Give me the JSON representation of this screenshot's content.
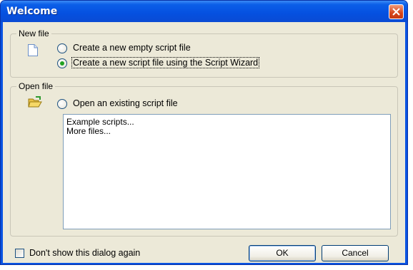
{
  "window": {
    "title": "Welcome"
  },
  "new_file": {
    "legend": "New file",
    "options": [
      {
        "label": "Create a new empty script file",
        "checked": false
      },
      {
        "label": "Create a new script file using the Script Wizard",
        "checked": true
      }
    ]
  },
  "open_file": {
    "legend": "Open file",
    "option": {
      "label": "Open an existing script file",
      "checked": false
    },
    "list_items": [
      "Example scripts...",
      "More files..."
    ]
  },
  "footer": {
    "dont_show_label": "Don't show this dialog again",
    "ok_label": "OK",
    "cancel_label": "Cancel"
  },
  "colors": {
    "titlebar": "#0550e0",
    "close_button": "#d6441a",
    "client_bg": "#ece9d8"
  }
}
